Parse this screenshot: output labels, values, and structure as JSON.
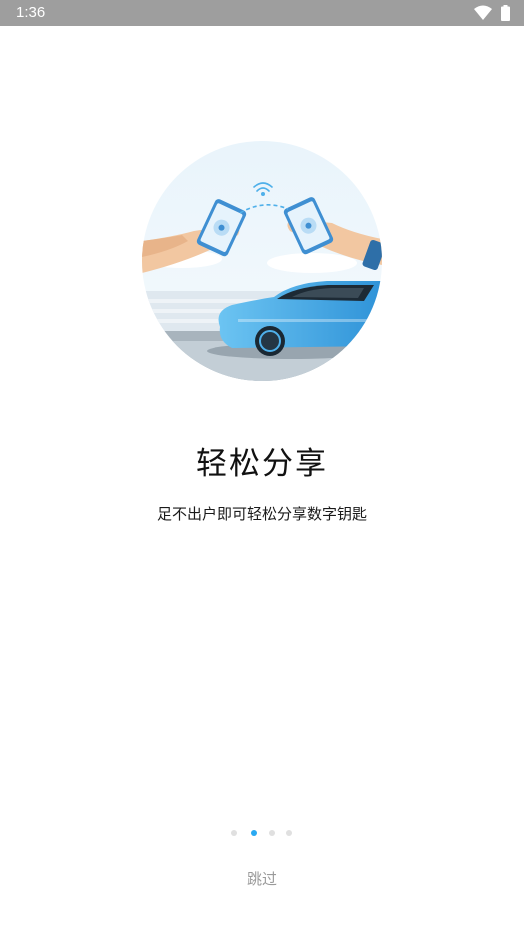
{
  "status_bar": {
    "time": "1:36",
    "icons": [
      "wifi-icon",
      "battery-icon"
    ]
  },
  "onboarding": {
    "title": "轻松分享",
    "subtitle": "足不出户即可轻松分享数字钥匙",
    "illustration": "hands-sharing-phone-key-car",
    "pager": {
      "total": 4,
      "active_index": 1
    },
    "skip_label": "跳过"
  },
  "colors": {
    "accent": "#29a9f2",
    "car_blue": "#4fb0ea",
    "status_bar": "#9e9e9e"
  }
}
